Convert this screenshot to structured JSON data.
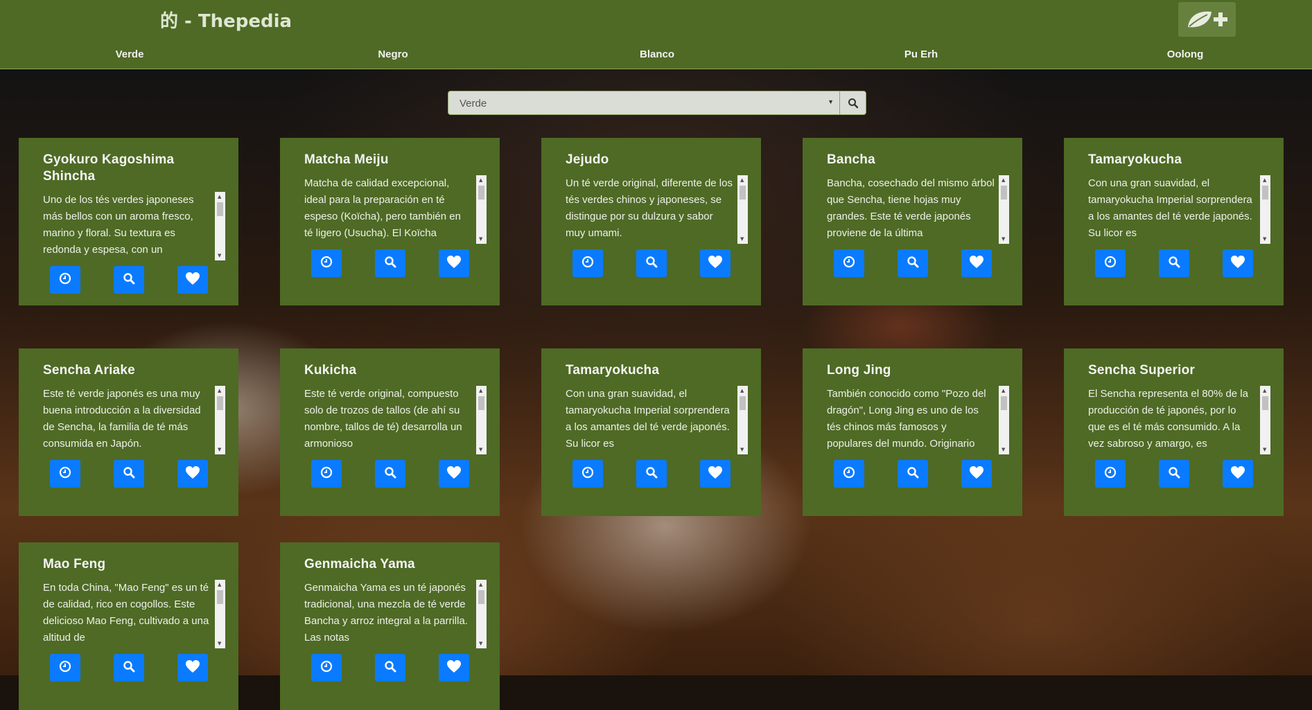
{
  "brand": "的 - Thepedia",
  "nav": [
    "Verde",
    "Negro",
    "Blanco",
    "Pu Erh",
    "Oolong"
  ],
  "search": {
    "selected": "Verde"
  },
  "cards": [
    {
      "title": "Gyokuro Kagoshima Shincha",
      "desc": "Uno de los tés verdes japoneses más bellos con un aroma fresco, marino y floral. Su textura es redonda y espesa, con un"
    },
    {
      "title": "Matcha Meiju",
      "desc": "Matcha de calidad excepcional, ideal para la preparación en té espeso (Koïcha), pero también en té ligero (Usucha). El Koïcha"
    },
    {
      "title": "Jejudo",
      "desc": "Un té verde original, diferente de los tés verdes chinos y japoneses, se distingue por su dulzura y sabor muy umami."
    },
    {
      "title": "Bancha",
      "desc": "Bancha, cosechado del mismo árbol que Sencha, tiene hojas muy grandes. Este té verde japonés proviene de la última"
    },
    {
      "title": "Tamaryokucha",
      "desc": "Con una gran suavidad, el tamaryokucha Imperial sorprendera a los amantes del té verde japonés. Su licor es"
    },
    {
      "title": "Sencha Ariake",
      "desc": "Este té verde japonés es una muy buena introducción a la diversidad de Sencha, la familia de té más consumida en Japón."
    },
    {
      "title": "Kukicha",
      "desc": "Este té verde original, compuesto solo de trozos de tallos (de ahí su nombre, tallos de té) desarrolla un armonioso"
    },
    {
      "title": "Tamaryokucha",
      "desc": "Con una gran suavidad, el tamaryokucha Imperial sorprendera a los amantes del té verde japonés. Su licor es"
    },
    {
      "title": "Long Jing",
      "desc": "También conocido como \"Pozo del dragón\", Long Jing es uno de los tés chinos más famosos y populares del mundo. Originario"
    },
    {
      "title": "Sencha Superior",
      "desc": "El Sencha representa el 80% de la producción de té japonés, por lo que es el té más consumido. A la vez sabroso y amargo, es"
    },
    {
      "title": "Mao Feng",
      "desc": "En toda China, \"Mao Feng\" es un té de calidad, rico en cogollos. Este delicioso Mao Feng, cultivado a una altitud de"
    },
    {
      "title": "Genmaicha Yama",
      "desc": "Genmaicha Yama es un té japonés tradicional, una mezcla de té verde Bancha y arroz integral a la parrilla. Las notas"
    }
  ],
  "icons": {
    "add": "leaf-plus-icon",
    "search": "search-icon",
    "time": "clock-icon",
    "detail": "search-icon",
    "fav": "heart-icon"
  },
  "colors": {
    "navbar": "#4e6a25",
    "card": "#4e6a25",
    "button": "#0a7bff"
  }
}
